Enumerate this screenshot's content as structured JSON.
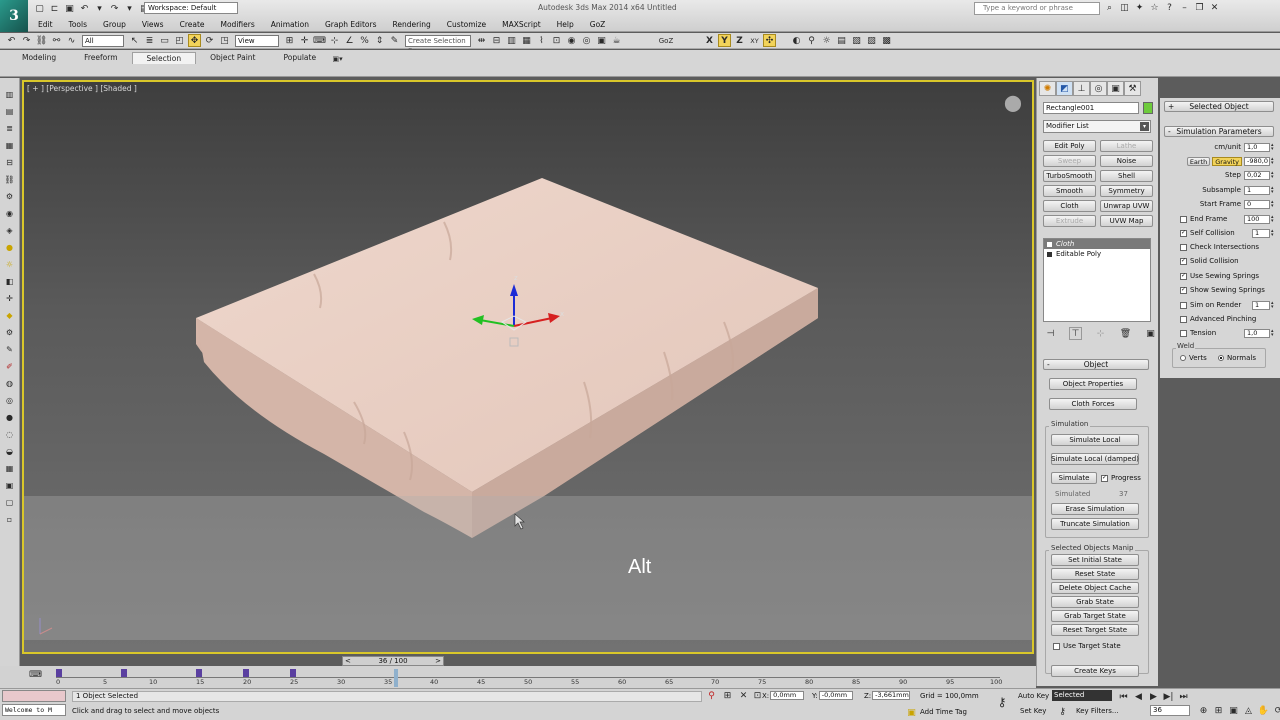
{
  "app": {
    "title": "Autodesk 3ds Max  2014 x64     Untitled",
    "workspace": "Workspace: Default",
    "search_placeholder": "Type a keyword or phrase"
  },
  "menu": [
    "Edit",
    "Tools",
    "Group",
    "Views",
    "Create",
    "Modifiers",
    "Animation",
    "Graph Editors",
    "Rendering",
    "Customize",
    "MAXScript",
    "Help",
    "GoZ"
  ],
  "toolbar": {
    "filter": "All",
    "ref_coord": "View",
    "selection_set": "Create Selection Se",
    "goz": "GoZ",
    "axis_x": "X",
    "axis_y": "Y",
    "axis_z": "Z",
    "axis_xy": "XY"
  },
  "ribbon_tabs": [
    {
      "label": "Modeling",
      "active": false
    },
    {
      "label": "Freeform",
      "active": false
    },
    {
      "label": "Selection",
      "active": true
    },
    {
      "label": "Object Paint",
      "active": false
    },
    {
      "label": "Populate",
      "active": false
    }
  ],
  "viewport": {
    "label": "[ + ] [Perspective ] [Shaded ]",
    "key_overlay": "Alt",
    "gizmo_x": "x",
    "gizmo_z": "z",
    "cloth_color": "#e7cbbf",
    "border_color": "#d9c72a"
  },
  "command_panel": {
    "object_name": "Rectangle001",
    "object_color": "#6ecb3c",
    "modifier_list": "Modifier List",
    "modifier_buttons": [
      {
        "label": "Edit Poly",
        "enabled": true
      },
      {
        "label": "Lathe",
        "enabled": false
      },
      {
        "label": "Sweep",
        "enabled": false
      },
      {
        "label": "Noise",
        "enabled": true
      },
      {
        "label": "TurboSmooth",
        "enabled": true
      },
      {
        "label": "Shell",
        "enabled": true
      },
      {
        "label": "Smooth",
        "enabled": true
      },
      {
        "label": "Symmetry",
        "enabled": true
      },
      {
        "label": "Cloth",
        "enabled": true
      },
      {
        "label": "Unwrap UVW",
        "enabled": true
      },
      {
        "label": "Extrude",
        "enabled": false
      },
      {
        "label": "UVW Map",
        "enabled": true
      }
    ],
    "stack": [
      {
        "label": "Cloth",
        "selected": true
      },
      {
        "label": "Editable Poly",
        "selected": false
      }
    ],
    "object_rollout": "Object",
    "object_properties": "Object Properties",
    "cloth_forces": "Cloth Forces",
    "simulation_group": "Simulation",
    "simulate_local": "Simulate Local",
    "simulate_local_damped": "Simulate Local (damped)",
    "simulate": "Simulate",
    "progress": "Progress",
    "progress_checked": true,
    "simulated_label": "Simulated",
    "simulated_value": "37",
    "erase_simulation": "Erase Simulation",
    "truncate_simulation": "Truncate Simulation",
    "selected_objects_manip": "Selected Objects Manip",
    "manip_buttons": [
      "Set Initial State",
      "Reset State",
      "Delete Object Cache",
      "Grab State",
      "Grab Target State",
      "Reset Target State"
    ],
    "use_target_state": "Use Target State",
    "create_keys": "Create Keys"
  },
  "sim_panel": {
    "selected_object": "Selected Object",
    "simulation_parameters": "Simulation Parameters",
    "cm_unit_label": "cm/unit",
    "cm_unit": "1,0",
    "earth": "Earth",
    "gravity_label": "Gravity",
    "gravity": "-980,0",
    "step_label": "Step",
    "step": "0,02",
    "subsample_label": "Subsample",
    "subsample": "1",
    "start_frame_label": "Start Frame",
    "start_frame": "0",
    "end_frame_label": "End Frame",
    "end_frame": "100",
    "checks": [
      {
        "label": "Self Collision",
        "checked": true,
        "value": "1"
      },
      {
        "label": "Check Intersections",
        "checked": false,
        "value": ""
      },
      {
        "label": "Solid Collision",
        "checked": true,
        "value": ""
      },
      {
        "label": "Use Sewing Springs",
        "checked": true,
        "value": ""
      },
      {
        "label": "Show Sewing Springs",
        "checked": true,
        "value": ""
      },
      {
        "label": "Sim on Render",
        "checked": false,
        "value": "1"
      },
      {
        "label": "Advanced Pinching",
        "checked": false,
        "value": ""
      },
      {
        "label": "Tension",
        "checked": false,
        "value": "1,0"
      }
    ],
    "weld_label": "Weld",
    "weld_verts": "Verts",
    "weld_normals": "Normals"
  },
  "timeline": {
    "slider_label": "36 / 100",
    "current_frame": 36,
    "end": 100,
    "ticks": [
      "0",
      "5",
      "10",
      "15",
      "20",
      "25",
      "30",
      "35",
      "40",
      "45",
      "50",
      "55",
      "60",
      "65",
      "70",
      "75",
      "80",
      "85",
      "90",
      "95",
      "100"
    ]
  },
  "status": {
    "maxscript": "Welcome to M",
    "selected": "1 Object Selected",
    "prompt": "Click and drag to select and move objects",
    "x_label": "X:",
    "x": "0,0mm",
    "y_label": "Y:",
    "y": "-0,0mm",
    "z_label": "Z:",
    "z": "-3,661mm",
    "grid": "Grid = 100,0mm",
    "add_time_tag": "Add Time Tag",
    "auto_key": "Auto Key",
    "auto_key_mode": "Selected",
    "set_key": "Set Key",
    "key_filters": "Key Filters...",
    "frame": "36"
  }
}
